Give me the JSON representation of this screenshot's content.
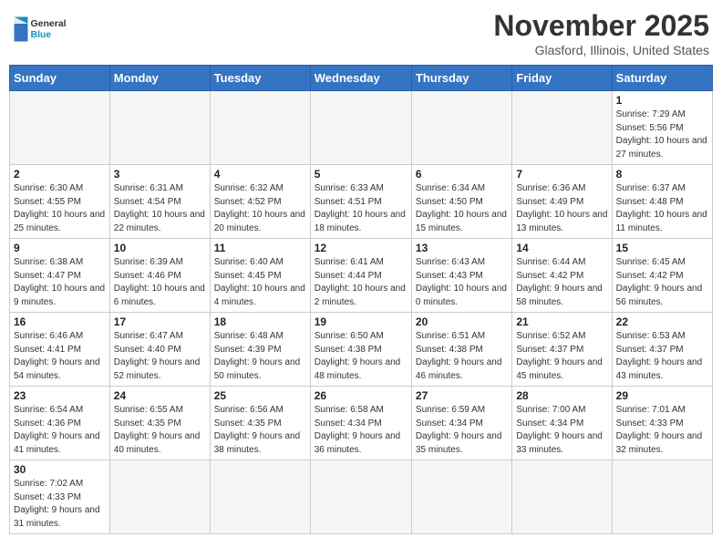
{
  "logo": {
    "general": "General",
    "blue": "Blue"
  },
  "title": "November 2025",
  "location": "Glasford, Illinois, United States",
  "weekdays": [
    "Sunday",
    "Monday",
    "Tuesday",
    "Wednesday",
    "Thursday",
    "Friday",
    "Saturday"
  ],
  "weeks": [
    [
      {
        "day": "",
        "info": ""
      },
      {
        "day": "",
        "info": ""
      },
      {
        "day": "",
        "info": ""
      },
      {
        "day": "",
        "info": ""
      },
      {
        "day": "",
        "info": ""
      },
      {
        "day": "",
        "info": ""
      },
      {
        "day": "1",
        "info": "Sunrise: 7:29 AM\nSunset: 5:56 PM\nDaylight: 10 hours and 27 minutes."
      }
    ],
    [
      {
        "day": "2",
        "info": "Sunrise: 6:30 AM\nSunset: 4:55 PM\nDaylight: 10 hours and 25 minutes."
      },
      {
        "day": "3",
        "info": "Sunrise: 6:31 AM\nSunset: 4:54 PM\nDaylight: 10 hours and 22 minutes."
      },
      {
        "day": "4",
        "info": "Sunrise: 6:32 AM\nSunset: 4:52 PM\nDaylight: 10 hours and 20 minutes."
      },
      {
        "day": "5",
        "info": "Sunrise: 6:33 AM\nSunset: 4:51 PM\nDaylight: 10 hours and 18 minutes."
      },
      {
        "day": "6",
        "info": "Sunrise: 6:34 AM\nSunset: 4:50 PM\nDaylight: 10 hours and 15 minutes."
      },
      {
        "day": "7",
        "info": "Sunrise: 6:36 AM\nSunset: 4:49 PM\nDaylight: 10 hours and 13 minutes."
      },
      {
        "day": "8",
        "info": "Sunrise: 6:37 AM\nSunset: 4:48 PM\nDaylight: 10 hours and 11 minutes."
      }
    ],
    [
      {
        "day": "9",
        "info": "Sunrise: 6:38 AM\nSunset: 4:47 PM\nDaylight: 10 hours and 9 minutes."
      },
      {
        "day": "10",
        "info": "Sunrise: 6:39 AM\nSunset: 4:46 PM\nDaylight: 10 hours and 6 minutes."
      },
      {
        "day": "11",
        "info": "Sunrise: 6:40 AM\nSunset: 4:45 PM\nDaylight: 10 hours and 4 minutes."
      },
      {
        "day": "12",
        "info": "Sunrise: 6:41 AM\nSunset: 4:44 PM\nDaylight: 10 hours and 2 minutes."
      },
      {
        "day": "13",
        "info": "Sunrise: 6:43 AM\nSunset: 4:43 PM\nDaylight: 10 hours and 0 minutes."
      },
      {
        "day": "14",
        "info": "Sunrise: 6:44 AM\nSunset: 4:42 PM\nDaylight: 9 hours and 58 minutes."
      },
      {
        "day": "15",
        "info": "Sunrise: 6:45 AM\nSunset: 4:42 PM\nDaylight: 9 hours and 56 minutes."
      }
    ],
    [
      {
        "day": "16",
        "info": "Sunrise: 6:46 AM\nSunset: 4:41 PM\nDaylight: 9 hours and 54 minutes."
      },
      {
        "day": "17",
        "info": "Sunrise: 6:47 AM\nSunset: 4:40 PM\nDaylight: 9 hours and 52 minutes."
      },
      {
        "day": "18",
        "info": "Sunrise: 6:48 AM\nSunset: 4:39 PM\nDaylight: 9 hours and 50 minutes."
      },
      {
        "day": "19",
        "info": "Sunrise: 6:50 AM\nSunset: 4:38 PM\nDaylight: 9 hours and 48 minutes."
      },
      {
        "day": "20",
        "info": "Sunrise: 6:51 AM\nSunset: 4:38 PM\nDaylight: 9 hours and 46 minutes."
      },
      {
        "day": "21",
        "info": "Sunrise: 6:52 AM\nSunset: 4:37 PM\nDaylight: 9 hours and 45 minutes."
      },
      {
        "day": "22",
        "info": "Sunrise: 6:53 AM\nSunset: 4:37 PM\nDaylight: 9 hours and 43 minutes."
      }
    ],
    [
      {
        "day": "23",
        "info": "Sunrise: 6:54 AM\nSunset: 4:36 PM\nDaylight: 9 hours and 41 minutes."
      },
      {
        "day": "24",
        "info": "Sunrise: 6:55 AM\nSunset: 4:35 PM\nDaylight: 9 hours and 40 minutes."
      },
      {
        "day": "25",
        "info": "Sunrise: 6:56 AM\nSunset: 4:35 PM\nDaylight: 9 hours and 38 minutes."
      },
      {
        "day": "26",
        "info": "Sunrise: 6:58 AM\nSunset: 4:34 PM\nDaylight: 9 hours and 36 minutes."
      },
      {
        "day": "27",
        "info": "Sunrise: 6:59 AM\nSunset: 4:34 PM\nDaylight: 9 hours and 35 minutes."
      },
      {
        "day": "28",
        "info": "Sunrise: 7:00 AM\nSunset: 4:34 PM\nDaylight: 9 hours and 33 minutes."
      },
      {
        "day": "29",
        "info": "Sunrise: 7:01 AM\nSunset: 4:33 PM\nDaylight: 9 hours and 32 minutes."
      }
    ],
    [
      {
        "day": "30",
        "info": "Sunrise: 7:02 AM\nSunset: 4:33 PM\nDaylight: 9 hours and 31 minutes."
      },
      {
        "day": "",
        "info": ""
      },
      {
        "day": "",
        "info": ""
      },
      {
        "day": "",
        "info": ""
      },
      {
        "day": "",
        "info": ""
      },
      {
        "day": "",
        "info": ""
      },
      {
        "day": "",
        "info": ""
      }
    ]
  ]
}
